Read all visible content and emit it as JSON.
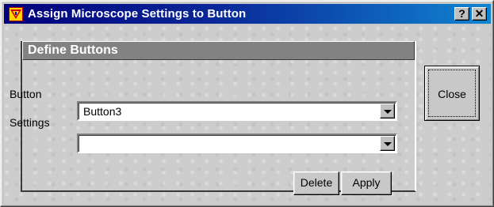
{
  "window": {
    "title": "Assign Microscope Settings to Button",
    "help_button": "?",
    "close_glyph": "✕"
  },
  "group": {
    "title": "Define Buttons"
  },
  "fields": {
    "button_label": "Button",
    "button_value": "Button3",
    "settings_label": "Settings",
    "settings_value": ""
  },
  "actions": {
    "delete": "Delete",
    "apply": "Apply",
    "close": "Close"
  },
  "colors": {
    "title_start": "#00007b",
    "title_end": "#1084d0",
    "group_header": "#828282",
    "face": "#c8c8c8"
  }
}
